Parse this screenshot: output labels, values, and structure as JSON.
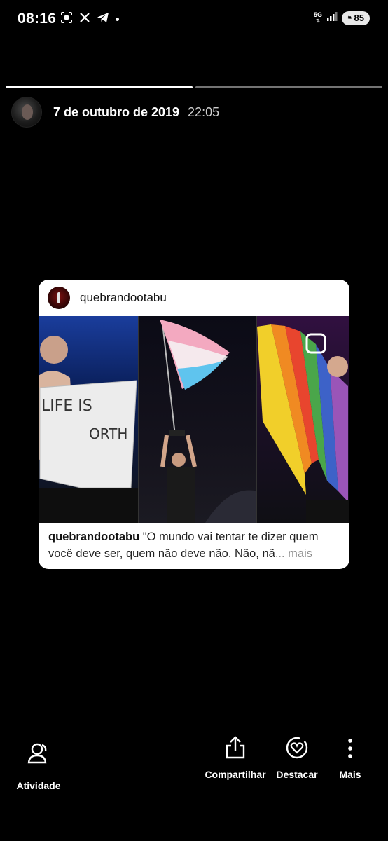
{
  "status_bar": {
    "time": "08:16",
    "network": "5G",
    "battery": "85",
    "icons": [
      "screenshot-icon",
      "x-icon",
      "telegram-icon",
      "notification-dot"
    ]
  },
  "story": {
    "progress": [
      1.0,
      0.0
    ],
    "date": "7 de outubro de 2019",
    "time": "22:05"
  },
  "post": {
    "username": "quebrandootabu",
    "caption_user": "quebrandootabu",
    "caption_text": " \"O mundo vai tentar te dizer quem você deve ser, quem não deve não. Não, nã",
    "more_label": "... mais"
  },
  "actions": {
    "activity": "Atividade",
    "share": "Compartilhar",
    "highlight": "Destacar",
    "more": "Mais"
  }
}
